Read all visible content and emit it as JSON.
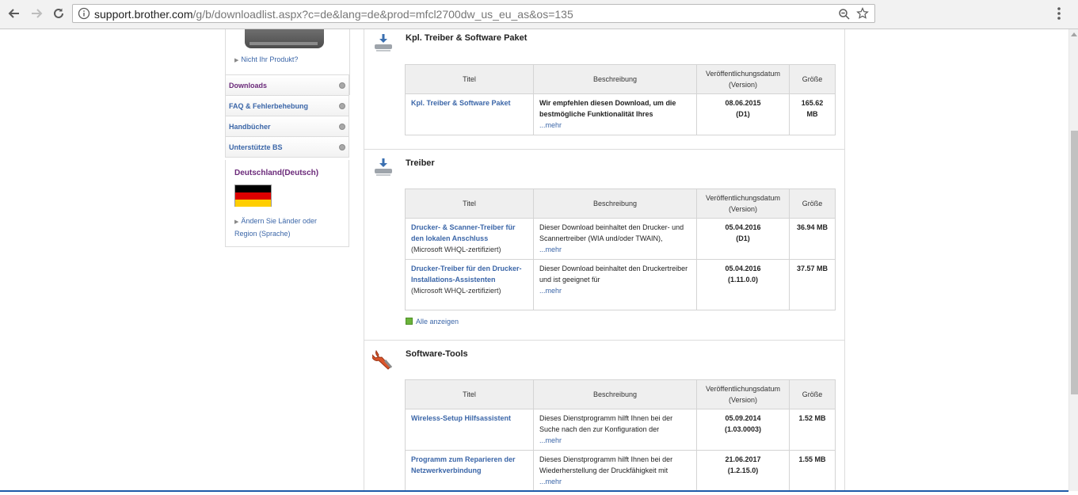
{
  "browser": {
    "url_host": "support.brother.com",
    "url_path": "/g/b/downloadlist.aspx?c=de&lang=de&prod=mfcl2700dw_us_eu_as&os=135"
  },
  "sidebar": {
    "not_your_product": "Nicht Ihr Produkt?",
    "menu": [
      {
        "label": "Downloads",
        "active": true
      },
      {
        "label": "FAQ & Fehlerbehebung",
        "active": false
      },
      {
        "label": "Handbücher",
        "active": false
      },
      {
        "label": "Unterstützte BS",
        "active": false
      }
    ],
    "country_title": "Deutschland(Deutsch)",
    "change_country": "Ändern Sie Länder oder Region (Sprache)",
    "flag_colors": [
      "#000000",
      "#dd0000",
      "#ffce00"
    ]
  },
  "columns": {
    "title": "Titel",
    "description": "Beschreibung",
    "date": "Veröffentlichungsdatum (Version)",
    "size": "Größe"
  },
  "sections": [
    {
      "title": "Kpl. Treiber & Software Paket",
      "icon": "download-icon",
      "rows": [
        {
          "title": "Kpl. Treiber & Software Paket",
          "sub": "",
          "description": "Wir empfehlen diesen Download, um die bestmögliche Funktionalität Ihres",
          "desc_bold": true,
          "more": "...mehr",
          "date": "08.06.2015",
          "version": "(D1)",
          "size": "165.62 MB"
        }
      ]
    },
    {
      "title": "Treiber",
      "icon": "download-icon",
      "rows": [
        {
          "title": "Drucker- & Scanner-Treiber für den lokalen Anschluss",
          "sub": "(Microsoft WHQL-zertifiziert)",
          "description": "Dieser Download beinhaltet den Drucker- und Scannertreiber (WIA und/oder TWAIN),",
          "desc_bold": false,
          "more": "...mehr",
          "date": "05.04.2016",
          "version": "(D1)",
          "size": "36.94 MB"
        },
        {
          "title": "Drucker-Treiber für den Drucker-Installations-Assistenten",
          "sub": "(Microsoft WHQL-zertifiziert)",
          "description": "Dieser Download beinhaltet den Druckertreiber und ist geeignet für",
          "desc_bold": false,
          "more": "...mehr",
          "date": "05.04.2016",
          "version": "(1.11.0.0)",
          "size": "37.57 MB"
        }
      ],
      "show_all": "Alle anzeigen"
    },
    {
      "title": "Software-Tools",
      "icon": "wrench-icon",
      "rows": [
        {
          "title": "Wireless-Setup Hilfsassistent",
          "sub": "",
          "description": "Dieses Dienstprogramm hilft Ihnen bei der Suche nach den zur Konfiguration der",
          "desc_bold": false,
          "more": "...mehr",
          "date": "05.09.2014",
          "version": "(1.03.0003)",
          "size": "1.52 MB"
        },
        {
          "title": "Programm zum Reparieren der Netzwerkverbindung",
          "sub": "",
          "description": "Dieses Dienstprogramm hilft Ihnen bei der Wiederherstellung der Druckfähigkeit mit",
          "desc_bold": false,
          "more": "...mehr",
          "date": "21.06.2017",
          "version": "(1.2.15.0)",
          "size": "1.55 MB"
        }
      ]
    }
  ]
}
